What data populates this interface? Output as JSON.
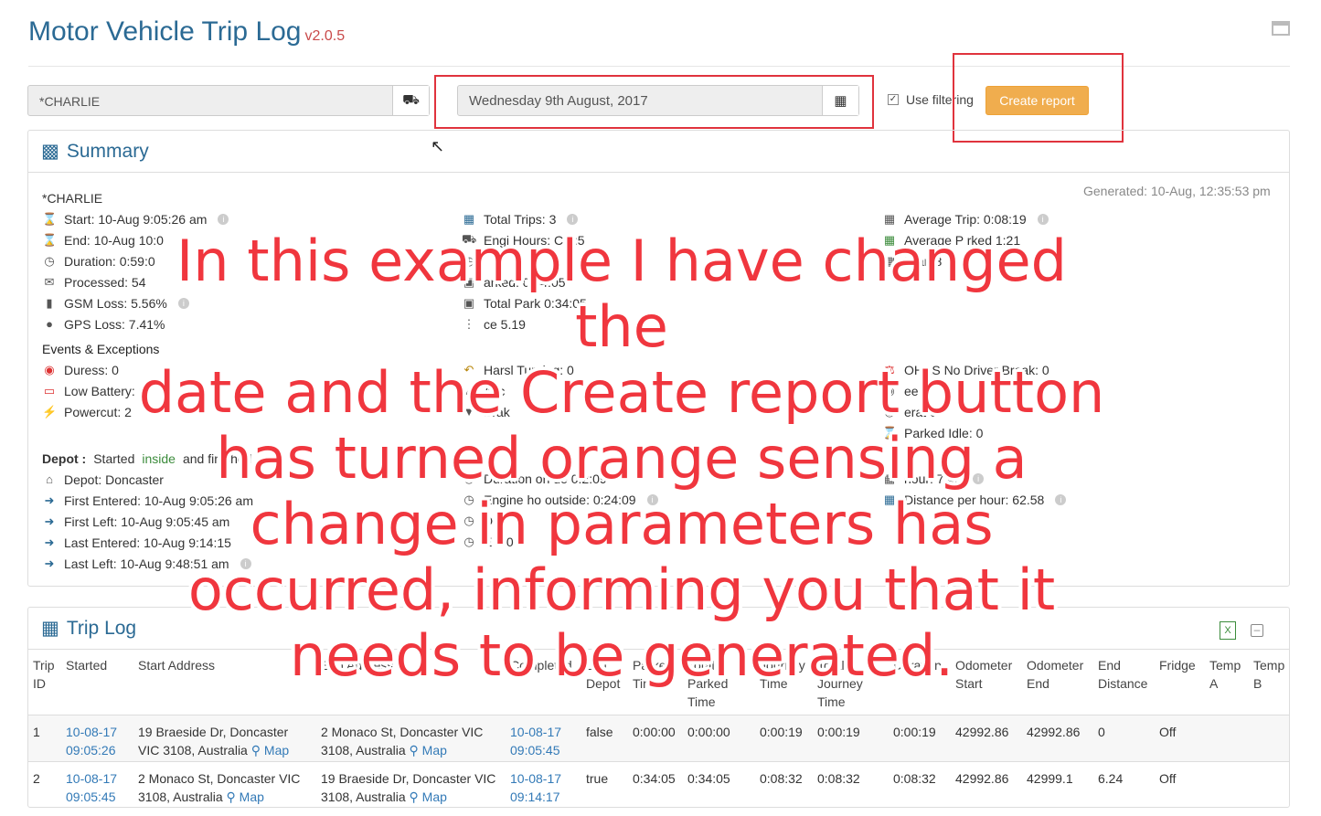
{
  "app": {
    "title": "Motor Vehicle Trip Log",
    "version": "v2.0.5"
  },
  "toolbar": {
    "vehicle_value": "*CHARLIE",
    "date_value": "Wednesday 9th August, 2017",
    "filter_label": "Use filtering",
    "create_label": "Create report"
  },
  "summary": {
    "title": "Summary",
    "generated": "Generated: 10-Aug, 12:35:53 pm",
    "vehicle": "*CHARLIE",
    "col1": [
      "Start: 10-Aug 9:05:26 am",
      "End: 10-Aug 10:0",
      "Duration: 0:59:0",
      "Processed: 54",
      "GSM Loss: 5.56%",
      "GPS Loss: 7.41%"
    ],
    "events_title": "Events & Exceptions",
    "events": [
      "Duress: 0",
      "Low Battery: 0",
      "Powercut: 2"
    ],
    "col2": [
      "Total Trips: 3",
      "Engi Hours: C 4:5",
      "",
      "arked: 0:34:05",
      "Total Park 0:34:05",
      "ce 5.19"
    ],
    "col2b": [
      "Harsl Turning: 0",
      "Acc",
      "Brak"
    ],
    "col3": [
      "Average Trip: 0:08:19",
      "Average P rked 1:21",
      "D an 8"
    ],
    "col3b": [
      "OH&S No Driver Break: 0",
      "ee",
      "erat 0",
      "Parked Idle: 0"
    ],
    "depot_line": {
      "prefix": "Depot :",
      "started": "Started",
      "inside": "inside",
      "finished": "and finished",
      "outside": "outs"
    },
    "depot": [
      "Depot: Doncaster",
      "First Entered: 10-Aug 9:05:26 am",
      "First Left: 10-Aug 9:05:45 am",
      "Last Entered: 10-Aug 9:14:15",
      "Last Left: 10-Aug 9:48:51 am"
    ],
    "depot2": [
      "Duration on de 0:2:09",
      "Engine ho outside: 0:24:09",
      "D",
      "E e 0 5"
    ],
    "depot3": [
      "hour: 7.45",
      "Distance per hour: 62.58"
    ]
  },
  "overlay": {
    "lines": [
      "In this example I have changed the",
      "date  and the Create report button",
      "has turned orange sensing a",
      "change in parameters has",
      "occurred, informing you that it",
      "needs to be generated."
    ]
  },
  "triplog": {
    "title": "Trip Log",
    "headers": [
      "Trip ID",
      "Started",
      "Start Address",
      "End Address",
      "Completed",
      "Left Depot",
      "Parked Time",
      "Total Parked Time",
      "Journey Time",
      "Total Journey Time",
      "Duration",
      "Odometer Start",
      "Odometer End",
      "End Distance",
      "Fridge",
      "Temp A",
      "Temp B"
    ],
    "rows": [
      {
        "id": "1",
        "started": "10-08-17 09:05:26",
        "start_addr": "19 Braeside Dr, Doncaster VIC 3108, Australia",
        "end_addr": "2 Monaco St, Doncaster VIC 3108, Australia",
        "completed": "10-08-17 09:05:45",
        "left": "false",
        "parked": "0:00:00",
        "tparked": "0:00:00",
        "journey": "0:00:19",
        "tjourney": "0:00:19",
        "duration": "0:00:19",
        "odo_s": "42992.86",
        "odo_e": "42992.86",
        "dist": "0",
        "fridge": "Off"
      },
      {
        "id": "2",
        "started": "10-08-17 09:05:45",
        "start_addr": "2 Monaco St, Doncaster VIC 3108, Australia",
        "end_addr": "19 Braeside Dr, Doncaster VIC 3108, Australia",
        "completed": "10-08-17 09:14:17",
        "left": "true",
        "parked": "0:34:05",
        "tparked": "0:34:05",
        "journey": "0:08:32",
        "tjourney": "0:08:32",
        "duration": "0:08:32",
        "odo_s": "42992.86",
        "odo_e": "42999.1",
        "dist": "6.24",
        "fridge": "Off"
      }
    ],
    "map_label": "Map"
  }
}
